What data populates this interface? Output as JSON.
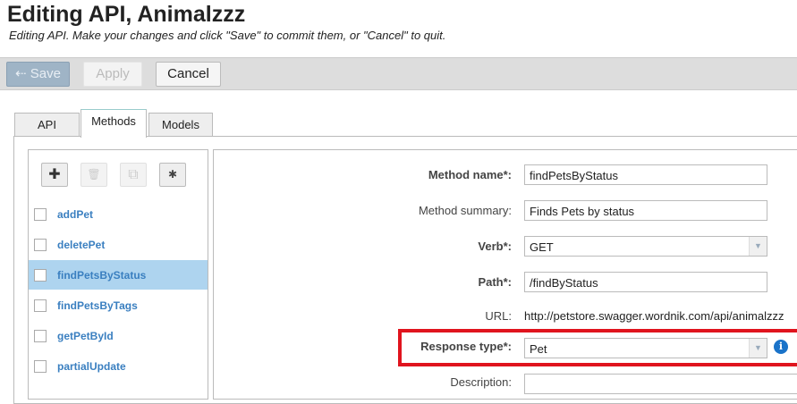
{
  "header": {
    "title": "Editing API, Animalzzz",
    "subtitle": "Editing API. Make your changes and click \"Save\" to commit them, or \"Cancel\" to quit."
  },
  "toolbar": {
    "save": "⇠ Save",
    "apply": "Apply",
    "cancel": "Cancel"
  },
  "tabs": [
    "API",
    "Methods",
    "Models"
  ],
  "list_tools": {
    "add": "✚",
    "delete": "🗑",
    "copy": "⧉",
    "wand": "✱"
  },
  "methods": [
    "addPet",
    "deletePet",
    "findPetsByStatus",
    "findPetsByTags",
    "getPetById",
    "partialUpdate"
  ],
  "selected_method": "findPetsByStatus",
  "form": {
    "method_name_label": "Method name*:",
    "method_name": "findPetsByStatus",
    "summary_label": "Method summary:",
    "summary": "Finds Pets by status",
    "verb_label": "Verb*:",
    "verb": "GET",
    "path_label": "Path*:",
    "path": "/findByStatus",
    "url_label": "URL:",
    "url": "http://petstore.swagger.wordnik.com/api/animalzzz",
    "response_label": "Response type*:",
    "response": "Pet",
    "description_label": "Description:",
    "info": "i"
  },
  "colors": {
    "highlight": "#e0141e",
    "link": "#3a7fc0",
    "selected": "#aed4ef"
  }
}
